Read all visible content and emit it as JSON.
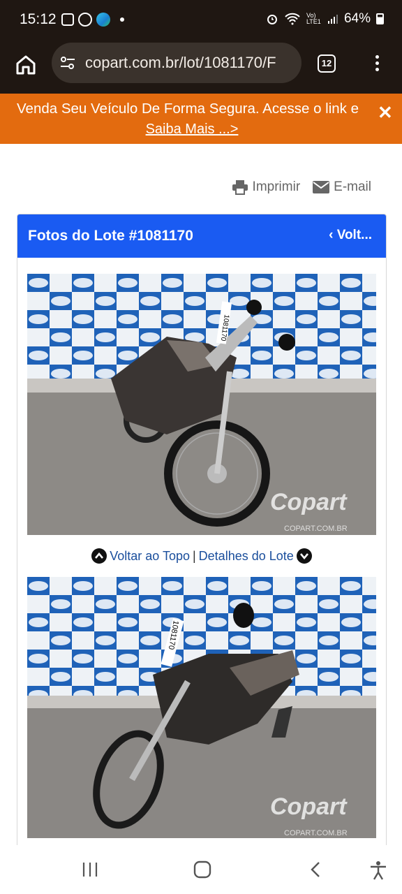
{
  "status_bar": {
    "time": "15:12",
    "signal_text": "Vo) LTE1",
    "battery": "64%"
  },
  "browser": {
    "url": "copart.com.br/lot/1081170/F",
    "tab_count": "12"
  },
  "banner": {
    "text": "Venda Seu Veículo De Forma Segura. Acesse o link e",
    "link": "Saiba Mais ...>"
  },
  "actions": {
    "print": "Imprimir",
    "email": "E-mail"
  },
  "panel": {
    "title": "Fotos do Lote #1081170",
    "back": "Volt..."
  },
  "photo_nav": {
    "top": "Voltar ao Topo",
    "separator": "|",
    "details": "Detalhes do Lote"
  },
  "watermark": {
    "logo": "Copart",
    "site": "COPART.COM.BR"
  },
  "lot_tag": "1081170",
  "colors": {
    "header_blue": "#1a5bf2",
    "banner_orange": "#e36b0f",
    "link_blue": "#1a4e9c",
    "status_bg": "#1f1712"
  }
}
